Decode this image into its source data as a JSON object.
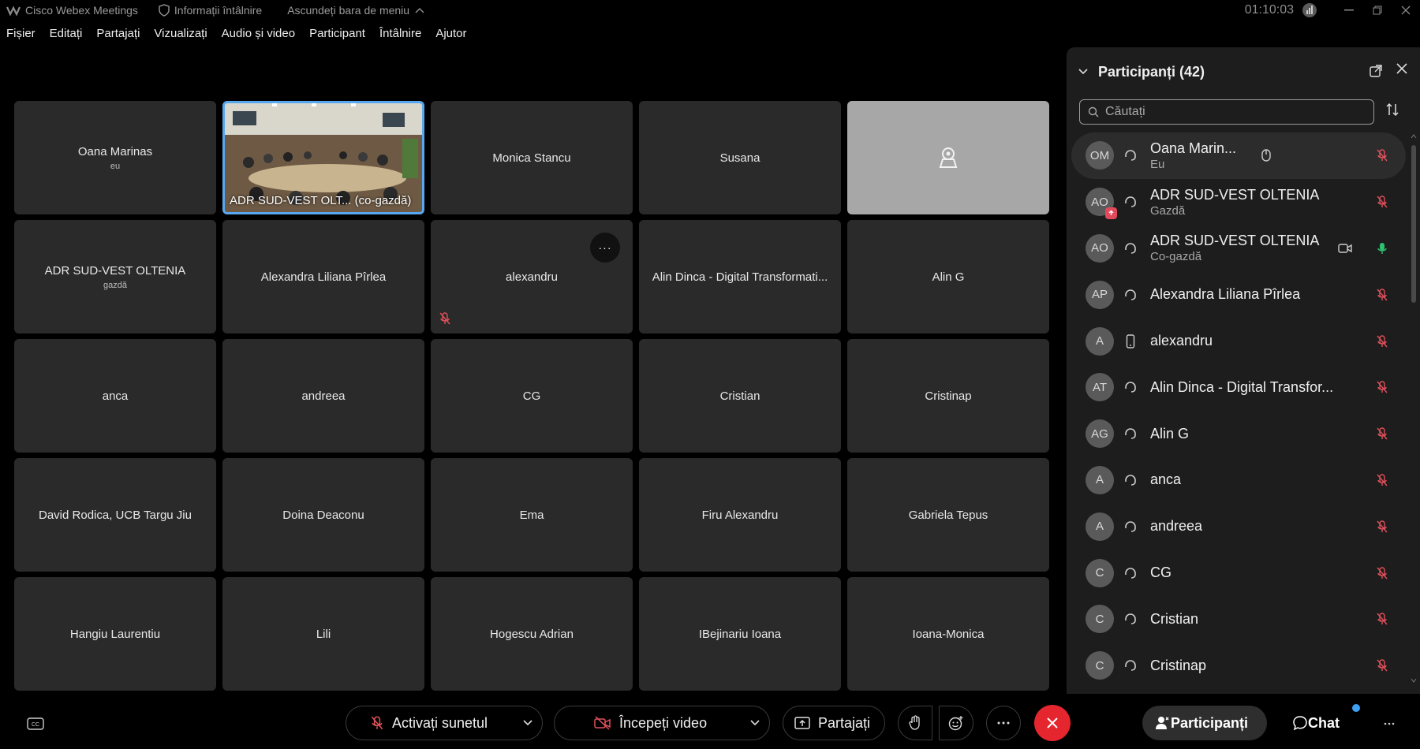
{
  "titlebar": {
    "app_name": "Cisco Webex Meetings",
    "meeting_info": "Informații întâlnire",
    "hide_menu": "Ascundeți bara de meniu",
    "timer": "01:10:03"
  },
  "menu": [
    "Fișier",
    "Editați",
    "Partajați",
    "Vizualizați",
    "Audio și video",
    "Participant",
    "Întâlnire",
    "Ajutor"
  ],
  "grid": [
    {
      "name": "Oana Marinas",
      "sub": "eu"
    },
    {
      "name": "ADR SUD-VEST OLT... (co-gazdă)",
      "sub": ""
    },
    {
      "name": "Monica Stancu",
      "sub": ""
    },
    {
      "name": "Susana",
      "sub": ""
    },
    {
      "name": "",
      "sub": ""
    },
    {
      "name": "ADR SUD-VEST OLTENIA",
      "sub": "gazdă"
    },
    {
      "name": "Alexandra Liliana Pîrlea",
      "sub": ""
    },
    {
      "name": "alexandru",
      "sub": ""
    },
    {
      "name": "Alin Dinca - Digital Transformati...",
      "sub": ""
    },
    {
      "name": "Alin G",
      "sub": ""
    },
    {
      "name": "anca",
      "sub": ""
    },
    {
      "name": "andreea",
      "sub": ""
    },
    {
      "name": "CG",
      "sub": ""
    },
    {
      "name": "Cristian",
      "sub": ""
    },
    {
      "name": "Cristinap",
      "sub": ""
    },
    {
      "name": "David Rodica, UCB Targu Jiu",
      "sub": ""
    },
    {
      "name": "Doina Deaconu",
      "sub": ""
    },
    {
      "name": "Ema",
      "sub": ""
    },
    {
      "name": "Firu Alexandru",
      "sub": ""
    },
    {
      "name": "Gabriela Tepus",
      "sub": ""
    },
    {
      "name": "Hangiu Laurentiu",
      "sub": ""
    },
    {
      "name": "Lili",
      "sub": ""
    },
    {
      "name": "Hogescu Adrian",
      "sub": ""
    },
    {
      "name": "IBejinariu Ioana",
      "sub": ""
    },
    {
      "name": "Ioana-Monica",
      "sub": ""
    }
  ],
  "panel": {
    "title": "Participanți (42)",
    "search_placeholder": "Căutați",
    "participants": [
      {
        "initials": "OM",
        "name": "Oana Marin...",
        "role": "Eu"
      },
      {
        "initials": "AO",
        "name": "ADR SUD-VEST OLTENIA",
        "role": "Gazdă"
      },
      {
        "initials": "AO",
        "name": "ADR SUD-VEST OLTENIA",
        "role": "Co-gazdă"
      },
      {
        "initials": "AP",
        "name": "Alexandra Liliana Pîrlea",
        "role": ""
      },
      {
        "initials": "A",
        "name": "alexandru",
        "role": ""
      },
      {
        "initials": "AT",
        "name": "Alin Dinca - Digital Transfor...",
        "role": ""
      },
      {
        "initials": "AG",
        "name": "Alin G",
        "role": ""
      },
      {
        "initials": "A",
        "name": "anca",
        "role": ""
      },
      {
        "initials": "A",
        "name": "andreea",
        "role": ""
      },
      {
        "initials": "C",
        "name": "CG",
        "role": ""
      },
      {
        "initials": "C",
        "name": "Cristian",
        "role": ""
      },
      {
        "initials": "C",
        "name": "Cristinap",
        "role": ""
      }
    ]
  },
  "toolbar": {
    "unmute": "Activați sunetul",
    "start_video": "Începeți video",
    "share": "Partajați",
    "participants": "Participanți",
    "chat": "Chat"
  },
  "colors": {
    "accent": "#58a8f0",
    "mute_red": "#e0515c",
    "end_red": "#e5262e",
    "mic_green": "#2fbf71"
  }
}
